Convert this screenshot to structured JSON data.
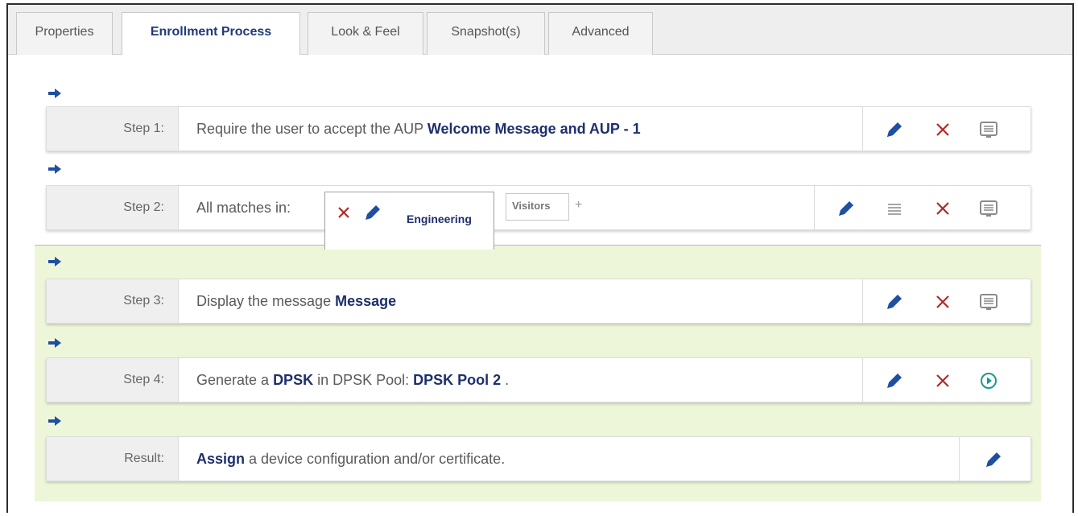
{
  "tabs": [
    "Properties",
    "Enrollment Process",
    "Look & Feel",
    "Snapshot(s)",
    "Advanced"
  ],
  "active_tab": "Enrollment Process",
  "steps": [
    {
      "label": "Step 1:",
      "text_pre": "Require the user to accept the AUP ",
      "text_bold": "Welcome Message and AUP - 1",
      "actions": [
        "edit-icon",
        "delete-icon",
        "message-icon"
      ]
    },
    {
      "label": "Step 2:",
      "text_pre": "All matches in:",
      "groups": [
        {
          "name": "Engineering",
          "active": true
        },
        {
          "name": "Visitors",
          "active": false
        }
      ],
      "add_symbol": "+",
      "actions": [
        "edit-icon",
        "list-icon",
        "delete-icon",
        "message-icon"
      ]
    },
    {
      "label": "Step 3:",
      "text_pre": "Display the message ",
      "text_bold": "Message",
      "actions": [
        "edit-icon",
        "delete-icon",
        "message-icon"
      ]
    },
    {
      "label": "Step 4:",
      "text_1": "Generate a ",
      "text_bold_1": "DPSK",
      "text_2": " in DPSK Pool: ",
      "text_bold_2": "DPSK Pool 2",
      "text_3": " .",
      "actions": [
        "edit-icon",
        "delete-icon",
        "play-circle-icon"
      ]
    },
    {
      "label": "Result:",
      "text_bold": "Assign",
      "text_post": " a device configuration and/or certificate.",
      "actions": [
        "edit-icon"
      ]
    }
  ],
  "colors": {
    "accent_blue": "#1e4fa0",
    "delete_red": "#b52828",
    "play_teal": "#1a9a8a",
    "group_bg": "#eef6da"
  }
}
